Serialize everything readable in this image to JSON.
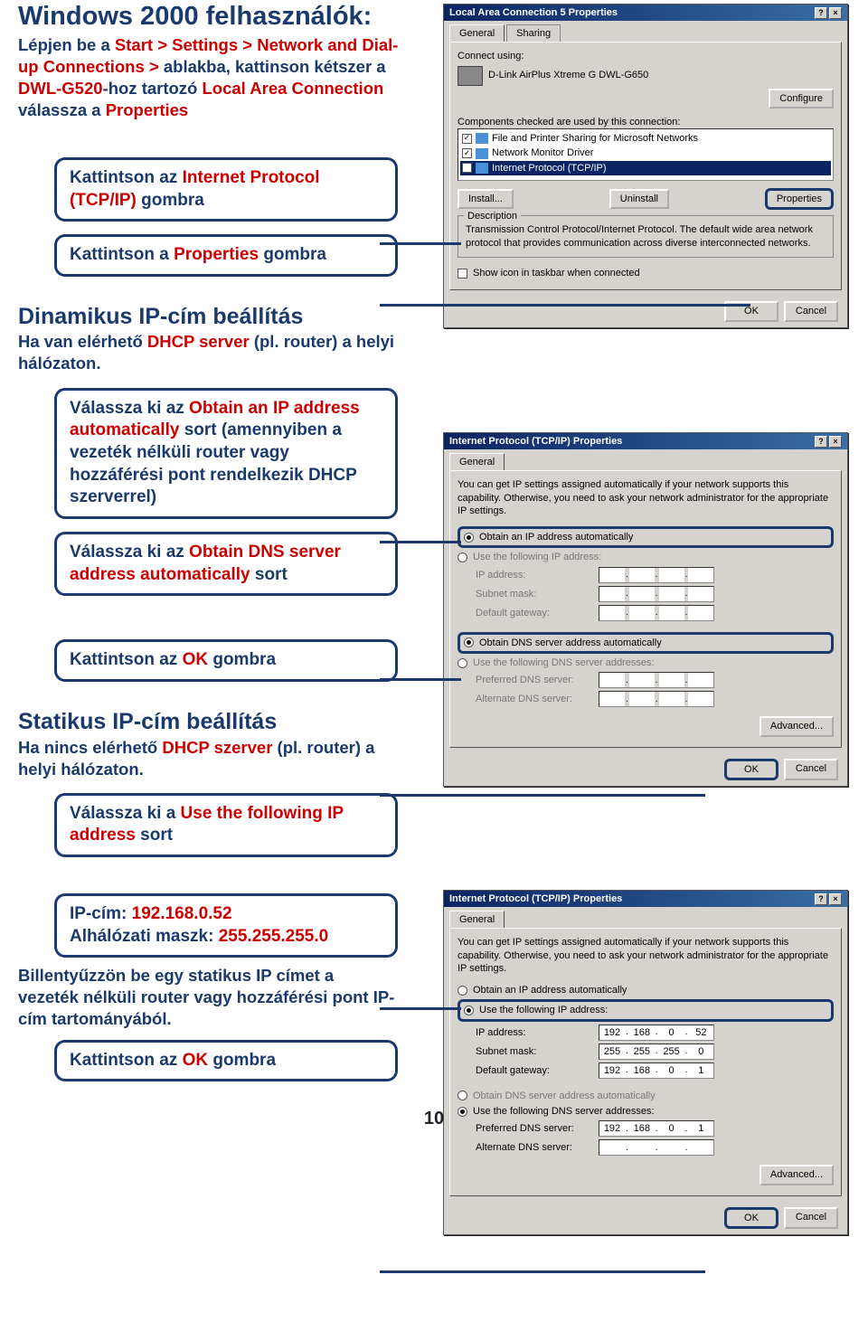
{
  "page_number": "10",
  "section1": {
    "heading": "Windows 2000 felhasználók:",
    "intro_pre": "Lépjen be a ",
    "intro_red": "Start > Settings > Network and Dial-up Connections >",
    "intro_post1": " ablakba, kattinson kétszer a ",
    "intro_red2": "DWL-G520",
    "intro_post2": "-hoz tartozó ",
    "intro_red3": "Local Area Connection",
    "intro_post3": " válassza a ",
    "intro_red4": "Properties"
  },
  "callout1_pre": "Kattintson az ",
  "callout1_red": "Internet Protocol (TCP/IP)",
  "callout1_post": " gombra",
  "callout2_pre": "Kattintson a ",
  "callout2_red": "Properties",
  "callout2_post": " gombra",
  "section2": {
    "heading": "Dinamikus IP-cím beállítás",
    "sub_pre": "Ha van elérhető ",
    "sub_red": "DHCP server",
    "sub_post": " (pl. router) a helyi hálózaton."
  },
  "callout3_pre": "Válassza ki az ",
  "callout3_red": "Obtain an IP address automatically",
  "callout3_post": " sort (amennyiben a vezeték nélküli router vagy hozzáférési pont rendelkezik DHCP szerverrel)",
  "callout4_pre": "Válassza ki az ",
  "callout4_red": "Obtain DNS server address automatically",
  "callout4_post": " sort",
  "callout5_pre": "Kattintson az ",
  "callout5_red": "OK",
  "callout5_post": " gombra",
  "section3": {
    "heading": "Statikus IP-cím beállítás",
    "sub_pre": "Ha nincs elérhető ",
    "sub_red": "DHCP szerver",
    "sub_post": " (pl. router) a helyi hálózaton."
  },
  "callout6_pre": "Válassza ki a ",
  "callout6_red": "Use the following IP address",
  "callout6_post": " sort",
  "callout7_a": "IP-cím: ",
  "callout7_a_red": "192.168.0.52",
  "callout7_b": "Alhálózati maszk: ",
  "callout7_b_red": "255.255.255.0",
  "static_note": "Billentyűzzön be egy statikus IP címet a vezeték nélküli router vagy hozzáférési pont IP-cím tartományából.",
  "callout8_pre": "Kattintson az ",
  "callout8_red": "OK",
  "callout8_post": " gombra",
  "dlg1": {
    "title": "Local Area Connection 5 Properties",
    "tab_general": "General",
    "tab_sharing": "Sharing",
    "connect_label": "Connect using:",
    "adapter": "D-Link AirPlus Xtreme G DWL-G650",
    "configure": "Configure",
    "components_label": "Components checked are used by this connection:",
    "comp1": "File and Printer Sharing for Microsoft Networks",
    "comp2": "Network Monitor Driver",
    "comp3": "Internet Protocol (TCP/IP)",
    "install": "Install...",
    "uninstall": "Uninstall",
    "properties": "Properties",
    "description_legend": "Description",
    "description": "Transmission Control Protocol/Internet Protocol. The default wide area network protocol that provides communication across diverse interconnected networks.",
    "show_icon": "Show icon in taskbar when connected",
    "ok": "OK",
    "cancel": "Cancel"
  },
  "dlg2": {
    "title": "Internet Protocol (TCP/IP) Properties",
    "tab_general": "General",
    "info": "You can get IP settings assigned automatically if your network supports this capability. Otherwise, you need to ask your network administrator for the appropriate IP settings.",
    "opt_auto_ip": "Obtain an IP address automatically",
    "opt_use_ip": "Use the following IP address:",
    "ip_label": "IP address:",
    "subnet_label": "Subnet mask:",
    "gateway_label": "Default gateway:",
    "opt_auto_dns": "Obtain DNS server address automatically",
    "opt_use_dns": "Use the following DNS server addresses:",
    "pref_dns": "Preferred DNS server:",
    "alt_dns": "Alternate DNS server:",
    "advanced": "Advanced...",
    "ok": "OK",
    "cancel": "Cancel"
  },
  "dlg3": {
    "title": "Internet Protocol (TCP/IP) Properties",
    "tab_general": "General",
    "info": "You can get IP settings assigned automatically if your network supports this capability. Otherwise, you need to ask your network administrator for the appropriate IP settings.",
    "opt_auto_ip": "Obtain an IP address automatically",
    "opt_use_ip": "Use the following IP address:",
    "ip_label": "IP address:",
    "ip_value": [
      "192",
      "168",
      "0",
      "52"
    ],
    "subnet_label": "Subnet mask:",
    "subnet_value": [
      "255",
      "255",
      "255",
      "0"
    ],
    "gateway_label": "Default gateway:",
    "gateway_value": [
      "192",
      "168",
      "0",
      "1"
    ],
    "opt_auto_dns": "Obtain DNS server address automatically",
    "opt_use_dns": "Use the following DNS server addresses:",
    "pref_dns": "Preferred DNS server:",
    "pref_dns_value": [
      "192",
      "168",
      "0",
      "1"
    ],
    "alt_dns": "Alternate DNS server:",
    "advanced": "Advanced...",
    "ok": "OK",
    "cancel": "Cancel"
  }
}
